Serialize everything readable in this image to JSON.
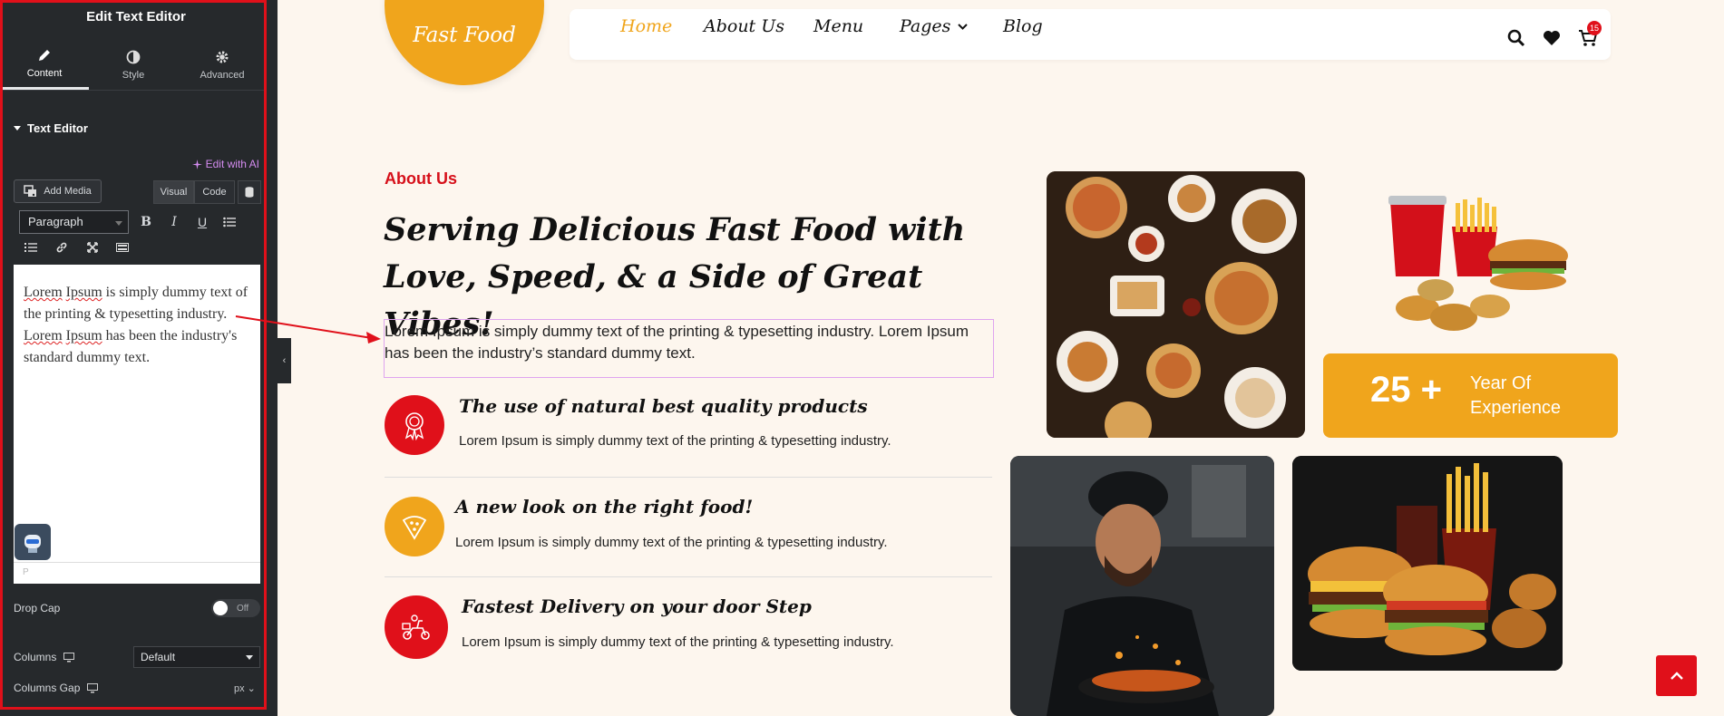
{
  "panel": {
    "title": "Edit Text Editor",
    "tabs": [
      {
        "label": "Content",
        "icon": "pencil-icon"
      },
      {
        "label": "Style",
        "icon": "contrast-icon"
      },
      {
        "label": "Advanced",
        "icon": "gear-icon"
      }
    ],
    "section_title": "Text Editor",
    "ai_link": "Edit with AI",
    "add_media": "Add Media",
    "editor_tabs": {
      "visual": "Visual",
      "code": "Code"
    },
    "format_select": "Paragraph",
    "editor_content": {
      "w1": "Lorem",
      "w2": "Ipsum",
      "t1": " is simply dummy text of the printing & typesetting industry.",
      "w3": "Lorem",
      "w4": "Ipsum",
      "t2": " has been the industry's standard dummy text."
    },
    "status_path": "P",
    "drop_cap": {
      "label": "Drop Cap",
      "value": "Off"
    },
    "columns": {
      "label": "Columns",
      "value": "Default"
    },
    "columns_gap": {
      "label": "Columns Gap",
      "unit": "px"
    }
  },
  "site": {
    "logo": "Fast Food",
    "nav": [
      "Home",
      "About Us",
      "Menu",
      "Pages",
      "Blog"
    ],
    "cart_count": "15",
    "kicker": "About Us",
    "headline": "Serving Delicious Fast Food with Love, Speed, & a Side of Great Vibes!",
    "lead": "Lorem Ipsum is simply dummy text of the printing & typesetting industry. Lorem Ipsum has been the industry’s standard dummy text.",
    "features": [
      {
        "title": "The use of natural best quality products",
        "text": "Lorem Ipsum is simply dummy text of the printing & typesetting industry.",
        "icon": "award-badge-icon",
        "color": "#e0101a"
      },
      {
        "title": "A new look on the right food!",
        "text": "Lorem Ipsum is simply dummy text of the printing & typesetting industry.",
        "icon": "pizza-slice-icon",
        "color": "#f0a51c"
      },
      {
        "title": "Fastest Delivery on your door Step",
        "text": "Lorem Ipsum is simply dummy text of the printing & typesetting industry.",
        "icon": "delivery-scooter-icon",
        "color": "#e0101a"
      }
    ],
    "experience": {
      "number": "25 +",
      "label": "Year Of Experience"
    },
    "colors": {
      "accent": "#f0a51c",
      "red": "#e0101a",
      "background": "#fdf6ee",
      "panel": "#26292c"
    }
  }
}
